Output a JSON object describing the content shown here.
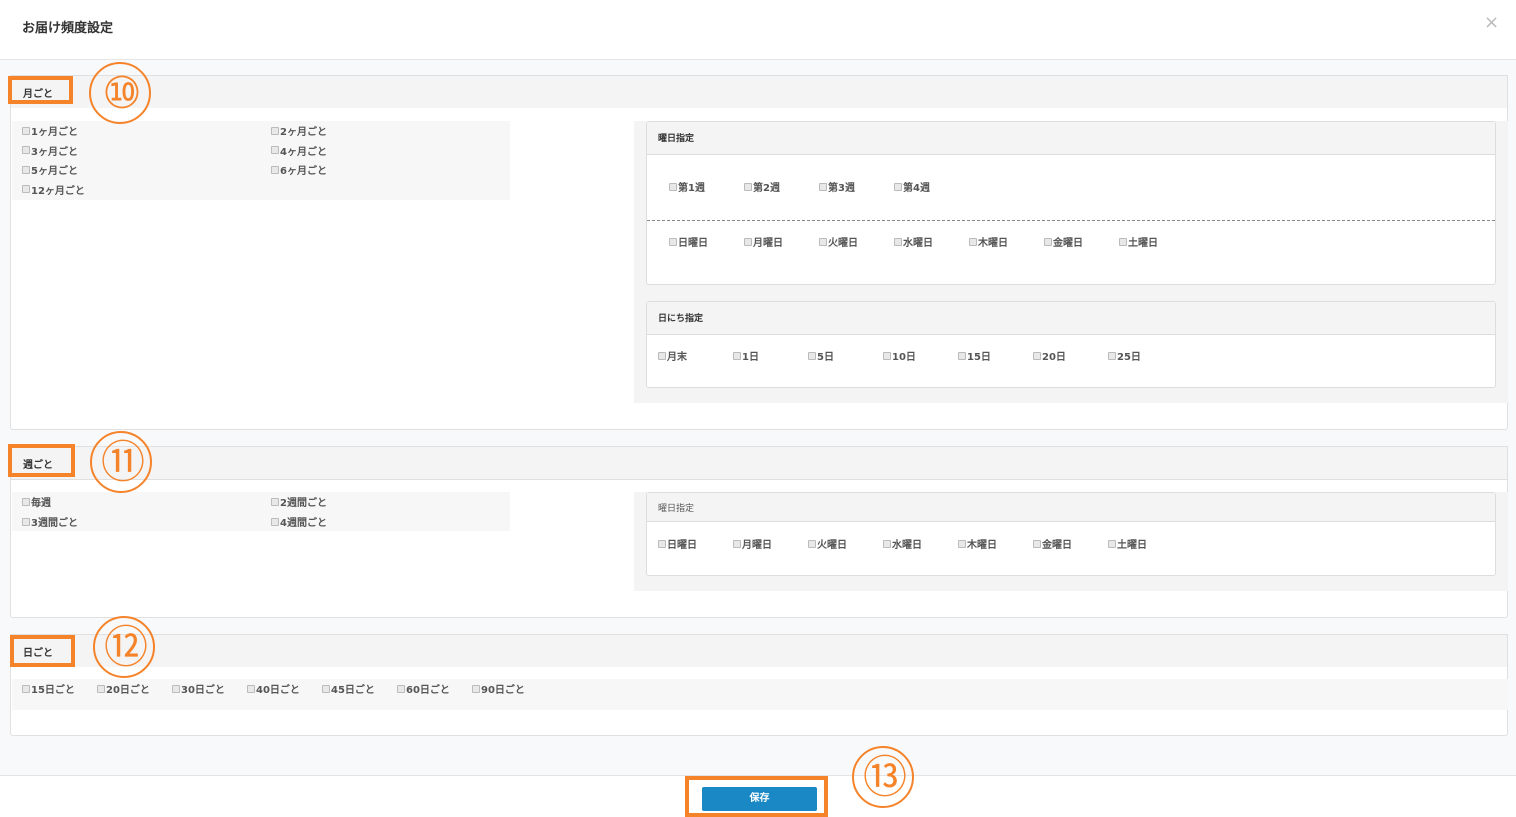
{
  "dialog": {
    "title": "お届け頻度設定",
    "close_icon": "close-icon"
  },
  "monthly": {
    "label": "月ごと",
    "annotation": "⑩",
    "options": [
      "1ヶ月ごと",
      "2ヶ月ごと",
      "3ヶ月ごと",
      "4ヶ月ごと",
      "5ヶ月ごと",
      "6ヶ月ごと",
      "12ヶ月ごと"
    ],
    "weekday_box": {
      "title": "曜日指定",
      "weeks": [
        "第1週",
        "第2週",
        "第3週",
        "第4週"
      ],
      "days": [
        "日曜日",
        "月曜日",
        "火曜日",
        "水曜日",
        "木曜日",
        "金曜日",
        "土曜日"
      ]
    },
    "date_box": {
      "title": "日にち指定",
      "dates": [
        "月末",
        "1日",
        "5日",
        "10日",
        "15日",
        "20日",
        "25日"
      ]
    }
  },
  "weekly": {
    "label": "週ごと",
    "annotation": "⑪",
    "options": [
      "毎週",
      "2週間ごと",
      "3週間ごと",
      "4週間ごと"
    ],
    "weekday_box": {
      "title": "曜日指定",
      "days": [
        "日曜日",
        "月曜日",
        "火曜日",
        "水曜日",
        "木曜日",
        "金曜日",
        "土曜日"
      ]
    }
  },
  "daily": {
    "label": "日ごと",
    "annotation": "⑫",
    "options": [
      "15日ごと",
      "20日ごと",
      "30日ごと",
      "40日ごと",
      "45日ごと",
      "60日ごと",
      "90日ごと"
    ]
  },
  "footer": {
    "save_label": "保存",
    "annotation": "⑬"
  },
  "colors": {
    "annotation": "#f5832a",
    "primary": "#1a88c4"
  }
}
